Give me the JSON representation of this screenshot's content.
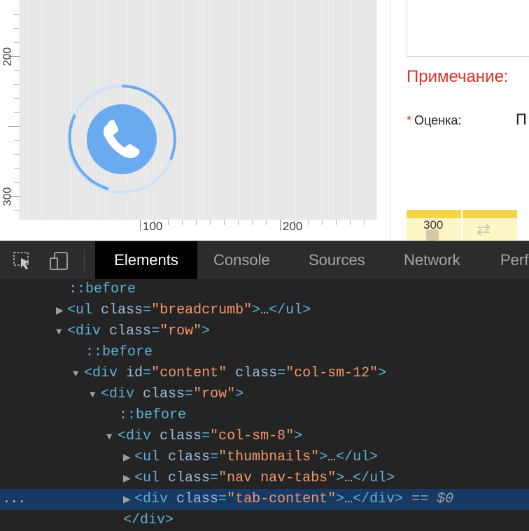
{
  "ruler": {
    "left_labels": [
      "200",
      "300"
    ],
    "bottom_labels": [
      "100",
      "200"
    ],
    "right_label": "300"
  },
  "form": {
    "note_label": "Примечание:",
    "required_mark": "*",
    "rating_label": "Оценка:",
    "rating_value_fragment": "П"
  },
  "icons": {
    "call": "phone-icon",
    "inspect": "cursor-select-icon",
    "device": "device-toggle-icon",
    "swap": "arrows-swap-icon"
  },
  "colors": {
    "call_circle": "#6aaaf0",
    "ring": "#6aaaf0",
    "note_red": "#d9342b",
    "selected_row": "#163a63"
  },
  "devtools": {
    "tabs": [
      {
        "label": "Elements",
        "active": true
      },
      {
        "label": "Console",
        "active": false
      },
      {
        "label": "Sources",
        "active": false
      },
      {
        "label": "Network",
        "active": false
      },
      {
        "label": "Perf",
        "active": false
      }
    ],
    "tree": [
      {
        "kind": "pseudo",
        "text": "::before"
      },
      {
        "kind": "el",
        "collapsed": true,
        "tag": "ul",
        "attrs": [
          {
            "name": "class",
            "value": "\"breadcrumb\""
          }
        ],
        "ellipsis": "…",
        "close": "</ul>"
      },
      {
        "kind": "el",
        "expanded": true,
        "tag": "div",
        "attrs": [
          {
            "name": "class",
            "value": "\"row\""
          }
        ]
      },
      {
        "kind": "pseudo",
        "text": "::before"
      },
      {
        "kind": "el",
        "expanded": true,
        "tag": "div",
        "attrs": [
          {
            "name": "id",
            "value": "\"content\""
          },
          {
            "name": "class",
            "value": "\"col-sm-12\""
          }
        ]
      },
      {
        "kind": "el",
        "expanded": true,
        "tag": "div",
        "attrs": [
          {
            "name": "class",
            "value": "\"row\""
          }
        ]
      },
      {
        "kind": "pseudo",
        "text": "::before"
      },
      {
        "kind": "el",
        "expanded": true,
        "tag": "div",
        "attrs": [
          {
            "name": "class",
            "value": "\"col-sm-8\""
          }
        ]
      },
      {
        "kind": "el",
        "collapsed": true,
        "tag": "ul",
        "attrs": [
          {
            "name": "class",
            "value": "\"thumbnails\""
          }
        ],
        "ellipsis": "…",
        "close": "</ul>"
      },
      {
        "kind": "el",
        "collapsed": true,
        "tag": "ul",
        "attrs": [
          {
            "name": "class",
            "value": "\"nav nav-tabs\""
          }
        ],
        "ellipsis": "…",
        "close": "</ul>"
      },
      {
        "kind": "el",
        "collapsed": true,
        "selected": true,
        "tag": "div",
        "attrs": [
          {
            "name": "class",
            "value": "\"tab-content\""
          }
        ],
        "ellipsis": "…",
        "close": "</div>",
        "suffix": "== $0"
      },
      {
        "kind": "close",
        "text": "</div>"
      }
    ],
    "row_indents": [
      4,
      3,
      3,
      5,
      4,
      5,
      7,
      6,
      7,
      7,
      7,
      7
    ],
    "selected_dots": "..."
  }
}
